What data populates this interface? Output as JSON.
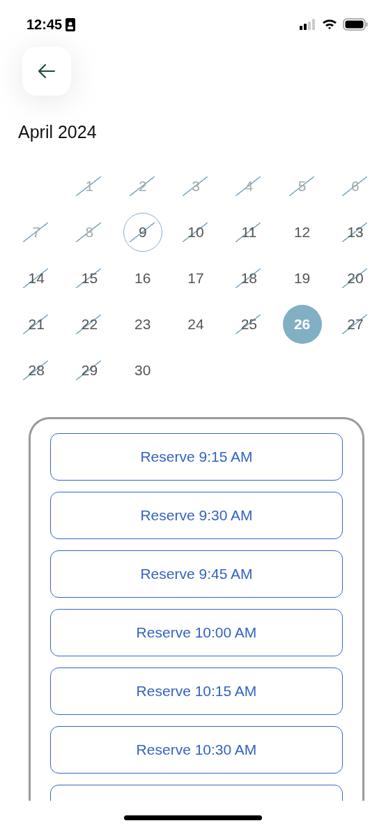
{
  "status_bar": {
    "time": "12:45"
  },
  "month_title": "April 2024",
  "days": [
    {
      "kind": "blank"
    },
    {
      "kind": "day",
      "label": "1",
      "past": true,
      "unavailable": true,
      "today": false,
      "selected": false
    },
    {
      "kind": "day",
      "label": "2",
      "past": true,
      "unavailable": true,
      "today": false,
      "selected": false
    },
    {
      "kind": "day",
      "label": "3",
      "past": true,
      "unavailable": true,
      "today": false,
      "selected": false
    },
    {
      "kind": "day",
      "label": "4",
      "past": true,
      "unavailable": true,
      "today": false,
      "selected": false
    },
    {
      "kind": "day",
      "label": "5",
      "past": true,
      "unavailable": true,
      "today": false,
      "selected": false
    },
    {
      "kind": "day",
      "label": "6",
      "past": true,
      "unavailable": true,
      "today": false,
      "selected": false
    },
    {
      "kind": "day",
      "label": "7",
      "past": true,
      "unavailable": true,
      "today": false,
      "selected": false
    },
    {
      "kind": "day",
      "label": "8",
      "past": true,
      "unavailable": true,
      "today": false,
      "selected": false
    },
    {
      "kind": "day",
      "label": "9",
      "past": false,
      "unavailable": true,
      "today": true,
      "selected": false
    },
    {
      "kind": "day",
      "label": "10",
      "past": false,
      "unavailable": true,
      "today": false,
      "selected": false
    },
    {
      "kind": "day",
      "label": "11",
      "past": false,
      "unavailable": true,
      "today": false,
      "selected": false
    },
    {
      "kind": "day",
      "label": "12",
      "past": false,
      "unavailable": false,
      "today": false,
      "selected": false
    },
    {
      "kind": "day",
      "label": "13",
      "past": false,
      "unavailable": true,
      "today": false,
      "selected": false
    },
    {
      "kind": "day",
      "label": "14",
      "past": false,
      "unavailable": true,
      "today": false,
      "selected": false
    },
    {
      "kind": "day",
      "label": "15",
      "past": false,
      "unavailable": true,
      "today": false,
      "selected": false
    },
    {
      "kind": "day",
      "label": "16",
      "past": false,
      "unavailable": false,
      "today": false,
      "selected": false
    },
    {
      "kind": "day",
      "label": "17",
      "past": false,
      "unavailable": false,
      "today": false,
      "selected": false
    },
    {
      "kind": "day",
      "label": "18",
      "past": false,
      "unavailable": true,
      "today": false,
      "selected": false
    },
    {
      "kind": "day",
      "label": "19",
      "past": false,
      "unavailable": false,
      "today": false,
      "selected": false
    },
    {
      "kind": "day",
      "label": "20",
      "past": false,
      "unavailable": true,
      "today": false,
      "selected": false
    },
    {
      "kind": "day",
      "label": "21",
      "past": false,
      "unavailable": true,
      "today": false,
      "selected": false
    },
    {
      "kind": "day",
      "label": "22",
      "past": false,
      "unavailable": true,
      "today": false,
      "selected": false
    },
    {
      "kind": "day",
      "label": "23",
      "past": false,
      "unavailable": false,
      "today": false,
      "selected": false
    },
    {
      "kind": "day",
      "label": "24",
      "past": false,
      "unavailable": false,
      "today": false,
      "selected": false
    },
    {
      "kind": "day",
      "label": "25",
      "past": false,
      "unavailable": true,
      "today": false,
      "selected": false
    },
    {
      "kind": "day",
      "label": "26",
      "past": false,
      "unavailable": false,
      "today": false,
      "selected": true
    },
    {
      "kind": "day",
      "label": "27",
      "past": false,
      "unavailable": true,
      "today": false,
      "selected": false
    },
    {
      "kind": "day",
      "label": "28",
      "past": false,
      "unavailable": true,
      "today": false,
      "selected": false
    },
    {
      "kind": "day",
      "label": "29",
      "past": false,
      "unavailable": true,
      "today": false,
      "selected": false
    },
    {
      "kind": "day",
      "label": "30",
      "past": false,
      "unavailable": false,
      "today": false,
      "selected": false
    }
  ],
  "slots": [
    {
      "kind": "button",
      "label": "Reserve 9:15 AM"
    },
    {
      "kind": "button",
      "label": "Reserve 9:30 AM"
    },
    {
      "kind": "button",
      "label": "Reserve 9:45 AM"
    },
    {
      "kind": "button",
      "label": "Reserve 10:00 AM"
    },
    {
      "kind": "button",
      "label": "Reserve 10:15 AM"
    },
    {
      "kind": "button",
      "label": "Reserve 10:30 AM"
    },
    {
      "kind": "cut"
    }
  ]
}
